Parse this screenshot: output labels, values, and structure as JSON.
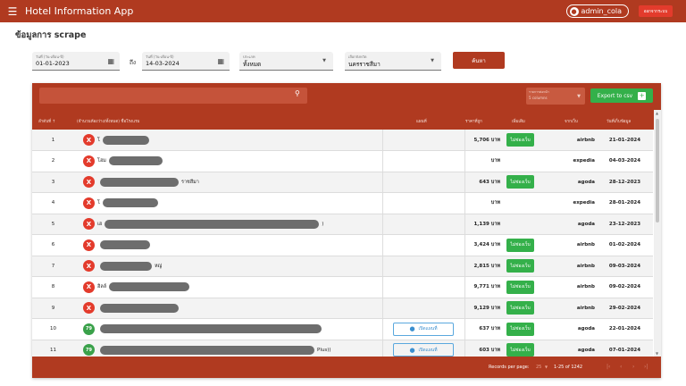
{
  "appbar": {
    "title": "Hotel Information App",
    "user": "admin_cola",
    "logout_label": "ออกจากระบบ"
  },
  "page": {
    "heading": "ข้อมูลการ scrape"
  },
  "filters": {
    "start_date_label": "วันที่ (วัน-เดือน-ปี)",
    "start_date_value": "01-01-2023",
    "to_label": "ถึง",
    "end_date_label": "วันที่ (วัน-เดือน-ปี)",
    "end_date_value": "14-03-2024",
    "type_label": "ประเภท",
    "type_value": "ทั้งหมด",
    "province_label": "เลือกจังหวัด",
    "province_value": "นครราชสีมา",
    "search_label": "ค้นหา"
  },
  "grid": {
    "perpage_label": "รายการต่อหน้า",
    "perpage_value": "5 columns",
    "export_label": "Export to csv",
    "columns": {
      "index": "ลำดับที่",
      "name": "(จำนวนห้องว่าง/ทั้งหมด) ชื่อโรงแรม",
      "map": "แผนที่",
      "price": "ราคาที่ถูก",
      "add": "เพิ่มเติม",
      "source": "จากเว็บ",
      "date": "วันที่เก็บข้อมูล"
    },
    "map_button_label": "เปิดแผนที่",
    "rows": [
      {
        "index": "1",
        "badge": "X",
        "name_prefix": "โ",
        "name_suffix": "",
        "price": "5,706 บาท",
        "add": "ไม่ช่องเว็บ",
        "source": "airbnb",
        "date": "21-01-2024"
      },
      {
        "index": "2",
        "badge": "X",
        "name_prefix": "โฮม",
        "name_suffix": "",
        "price": "บาท",
        "add": "",
        "source": "expedia",
        "date": "04-03-2024"
      },
      {
        "index": "3",
        "badge": "X",
        "name_prefix": "",
        "name_suffix": "ราชสีมา",
        "price": "643 บาท",
        "add": "ไม่ช่องเว็บ",
        "source": "agoda",
        "date": "28-12-2023"
      },
      {
        "index": "4",
        "badge": "X",
        "name_prefix": "โ",
        "name_suffix": "",
        "price": "บาท",
        "add": "",
        "source": "expedia",
        "date": "28-01-2024"
      },
      {
        "index": "5",
        "badge": "X",
        "name_prefix": "เฮ",
        "name_suffix": ")",
        "price": "1,139 บาท",
        "add": "",
        "source": "agoda",
        "date": "23-12-2023"
      },
      {
        "index": "6",
        "badge": "X",
        "name_prefix": "",
        "name_suffix": "",
        "price": "3,424 บาท",
        "add": "ไม่ช่องเว็บ",
        "source": "airbnb",
        "date": "01-02-2024"
      },
      {
        "index": "7",
        "badge": "X",
        "name_prefix": "",
        "name_suffix": "หญ่",
        "price": "2,815 บาท",
        "add": "ไม่ช่องเว็บ",
        "source": "airbnb",
        "date": "09-03-2024"
      },
      {
        "index": "8",
        "badge": "X",
        "name_prefix": "ฮิลล์",
        "name_suffix": "",
        "price": "9,771 บาท",
        "add": "ไม่ช่องเว็บ",
        "source": "airbnb",
        "date": "09-02-2024"
      },
      {
        "index": "9",
        "badge": "X",
        "name_prefix": "",
        "name_suffix": "",
        "price": "9,129 บาท",
        "add": "ไม่ช่องเว็บ",
        "source": "airbnb",
        "date": "29-02-2024"
      },
      {
        "index": "10",
        "badge": "79",
        "name_prefix": "",
        "name_suffix": "",
        "price": "637 บาท",
        "add": "ไม่ช่องเว็บ",
        "source": "agoda",
        "date": "22-01-2024"
      },
      {
        "index": "11",
        "badge": "79",
        "name_prefix": "",
        "name_suffix": "Plus))",
        "price": "603 บาท",
        "add": "ไม่ช่องเว็บ",
        "source": "agoda",
        "date": "07-01-2024"
      }
    ],
    "footer": {
      "records_per_page_label": "Records per page:",
      "records_per_page_value": "25",
      "range": "1-25 of 1242"
    }
  },
  "colors": {
    "primary": "#b03a20",
    "accent_green": "#34b04a",
    "danger": "#e33b2c",
    "map_blue": "#3b8fcf"
  },
  "icons": [
    "menu-icon",
    "account-circle-icon",
    "calendar-icon",
    "search-icon",
    "plus-icon",
    "map-pin-icon",
    "sort-arrow-icon",
    "first-page-icon",
    "prev-page-icon",
    "next-page-icon",
    "last-page-icon"
  ]
}
